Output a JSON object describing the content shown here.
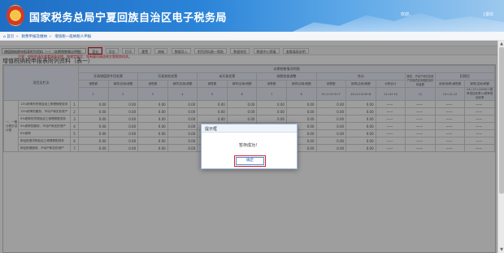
{
  "header": {
    "title": "国家税务总局宁夏回族自治区电子税务局",
    "user": "欢迎，",
    "logout": "[退出"
  },
  "breadcrumb": {
    "home": "首页",
    "item1": "税费申报及缴纳",
    "item2": "增值税一般纳税人申报"
  },
  "toolbar": {
    "select_value": "增值税纳税申报表附列资料（一）（本期销售情况明细）",
    "buttons": [
      "暂存",
      "导出",
      "打印",
      "重置",
      "刷新",
      "数据导入",
      "附列资料表一帮助",
      "数据校验",
      "数据中心预填",
      "查看填表说明"
    ]
  },
  "warning": "注意：申报前请先查看填表说明，按规定填写；如有疑问请咨询主管税务机关。",
  "form_title": "增值税纳税申报表附列资料（表一）",
  "table": {
    "group_header": "本期销售情况明细",
    "col_groups": [
      "开具增值税专用发票",
      "开具其他发票",
      "未开具发票",
      "纳税检查调整",
      "合计",
      "服务、不动产和无形资产扣除项目本期实际扣除金额",
      "扣除后"
    ],
    "sub_headers": [
      "销售额",
      "销项(应纳)税额",
      "销售额",
      "销项(应纳)税额",
      "销售额",
      "销项(应纳)税额",
      "销售额",
      "销项(应纳)税额",
      "销售额",
      "销项(应纳)税额",
      "价税合计",
      "",
      "含税(免税)销售额",
      "销项(应纳)税额"
    ],
    "col_nums": [
      "1",
      "2",
      "3",
      "4",
      "5",
      "6",
      "7",
      "8",
      "9=1+3+5+7",
      "10=2+4+6+8",
      "11=9+10",
      "12",
      "13=11-12",
      "14=13÷(100%+税率或征收率)×税率或征收率"
    ],
    "project_label": "项目及栏次",
    "section_label": "一、一般计税方法计税",
    "rows": [
      {
        "label": "13%税率的货物及加工修理修配劳务",
        "line": "1"
      },
      {
        "label": "13%税率的服务、不动产和无形资产",
        "line": "2"
      },
      {
        "label": "9%税率的货物及加工修理修配劳务",
        "line": "3"
      },
      {
        "label": "9%税率的服务、不动产和无形资产",
        "line": "4"
      },
      {
        "label": "6%税率",
        "line": "5"
      },
      {
        "label": "即征即退货物及加工修理修配劳务",
        "line": "6"
      },
      {
        "label": "即征即退服务、不动产和无形资产",
        "line": "7"
      }
    ],
    "zero": "0.00",
    "dash": "——"
  },
  "dialog": {
    "title": "提示框",
    "message": "暂存成功！",
    "ok": "确定"
  }
}
